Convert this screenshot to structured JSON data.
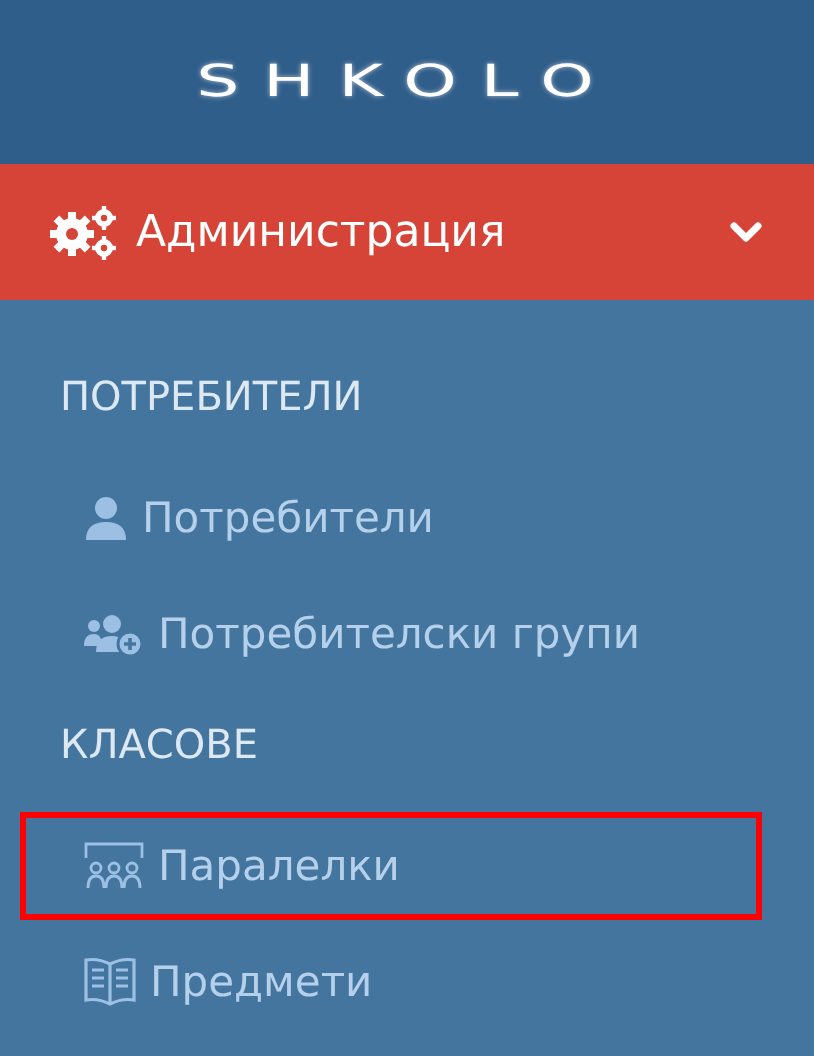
{
  "logo": "SHKOLO",
  "menu": {
    "label": "Администрация",
    "expanded": true
  },
  "sections": [
    {
      "title": "ПОТРЕБИТЕЛИ",
      "items": [
        {
          "label": "Потребители",
          "kind": "user",
          "highlighted": false
        },
        {
          "label": "Потребителски групи",
          "kind": "group",
          "highlighted": false
        }
      ]
    },
    {
      "title": "КЛАСОВЕ",
      "items": [
        {
          "label": "Паралелки",
          "kind": "classroom",
          "highlighted": true
        },
        {
          "label": "Предмети",
          "kind": "subject",
          "highlighted": false
        }
      ]
    }
  ]
}
